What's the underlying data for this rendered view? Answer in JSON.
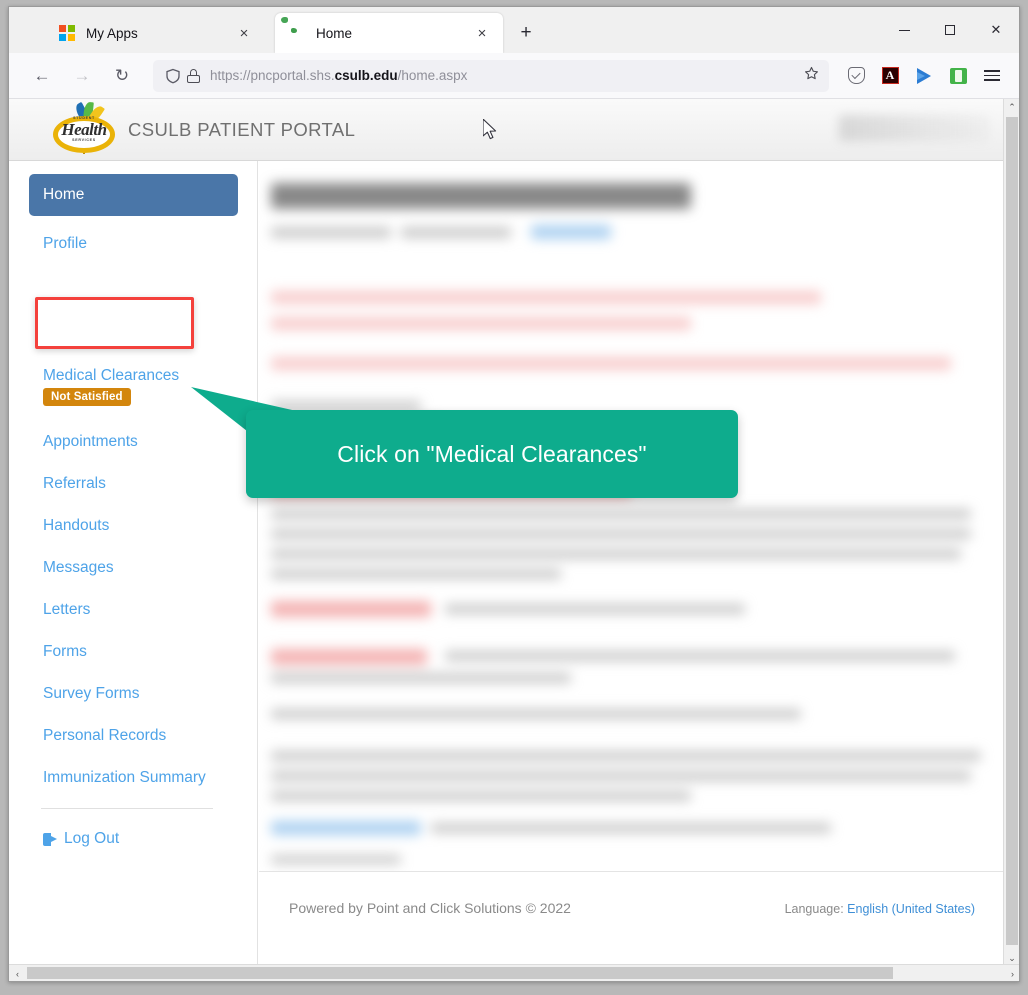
{
  "browser": {
    "tabs": [
      {
        "title": "My Apps",
        "favicon": "microsoft-logo-icon",
        "active": false,
        "close_label": "×"
      },
      {
        "title": "Home",
        "favicon": "globe-icon",
        "active": true,
        "close_label": "×"
      }
    ],
    "new_tab_label": "+",
    "window_controls": {
      "minimize": "–",
      "maximize": "□",
      "close": "✕"
    },
    "nav": {
      "back": "←",
      "forward": "→",
      "reload": "↻"
    },
    "url": {
      "prefix": "https://pncportal.shs.",
      "domain": "csulb.edu",
      "suffix": "/home.aspx",
      "full": "https://pncportal.shs.csulb.edu/home.aspx",
      "shield_icon": "shield-icon",
      "lock_icon": "lock-icon",
      "bookmark_icon": "star-icon"
    },
    "extensions": [
      {
        "name": "pocket-icon",
        "label": ""
      },
      {
        "name": "adobe-acrobat-icon",
        "label": "A"
      },
      {
        "name": "blue-arrow-extension-icon",
        "label": ""
      },
      {
        "name": "green-extension-icon",
        "label": ""
      },
      {
        "name": "hamburger-menu-icon",
        "label": ""
      }
    ]
  },
  "portal": {
    "logo": {
      "name": "student-health-services-logo",
      "word": "Health",
      "top_text": "STUDENT",
      "bottom_text": "SERVICES"
    },
    "title": "CSULB PATIENT PORTAL"
  },
  "sidebar": {
    "active_item": "Home",
    "items": [
      {
        "label": "Home",
        "active": true
      },
      {
        "label": "Profile",
        "active": false
      },
      {
        "label": "Medical Clearances",
        "active": false,
        "badge": "Not Satisfied"
      },
      {
        "label": "Appointments",
        "active": false
      },
      {
        "label": "Referrals",
        "active": false
      },
      {
        "label": "Handouts",
        "active": false
      },
      {
        "label": "Messages",
        "active": false
      },
      {
        "label": "Letters",
        "active": false
      },
      {
        "label": "Forms",
        "active": false
      },
      {
        "label": "Survey Forms",
        "active": false
      },
      {
        "label": "Personal Records",
        "active": false
      },
      {
        "label": "Immunization Summary",
        "active": false
      }
    ],
    "logout": {
      "label": "Log Out",
      "icon": "logout-icon"
    }
  },
  "callout": {
    "text": "Click on \"Medical Clearances\"",
    "background_color": "#0eac8d",
    "text_color": "#ffffff"
  },
  "highlight": {
    "target": "Medical Clearances",
    "border_color": "#f4413c"
  },
  "footer": {
    "powered_by": "Powered by Point and Click Solutions © 2022",
    "language_label": "Language:",
    "language_value": "English (United States)"
  },
  "scrollbars": {
    "vertical": {
      "up": "⌃",
      "down": "⌄"
    },
    "horizontal": {
      "left": "‹",
      "right": "›"
    }
  },
  "colors": {
    "sidebar_active": "#4a76a8",
    "sidebar_link": "#4ea3e8",
    "badge": "#d3860d",
    "callout": "#0eac8d",
    "highlight": "#f4413c"
  }
}
